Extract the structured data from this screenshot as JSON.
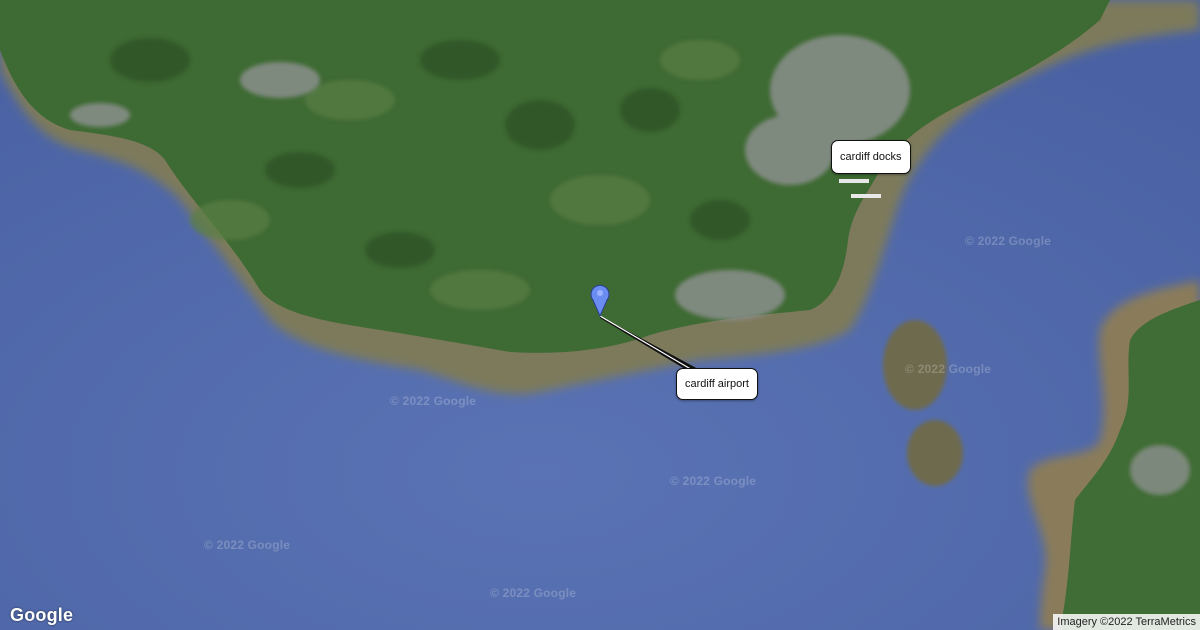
{
  "map": {
    "markers": [
      {
        "label": "cardiff airport",
        "icon": "map-pin-icon",
        "color": "#6b8df2"
      },
      {
        "label": "cardiff docks",
        "icon": "docks-marker-icon"
      }
    ],
    "watermark_text": "© 2022 Google",
    "logo": "Google",
    "attribution": "Imagery ©2022 TerraMetrics",
    "colors": {
      "sea": "#4f67a8",
      "land": "#3f6a34",
      "shallows": "#7a7a5a",
      "urban": "#8a8f8c"
    }
  }
}
